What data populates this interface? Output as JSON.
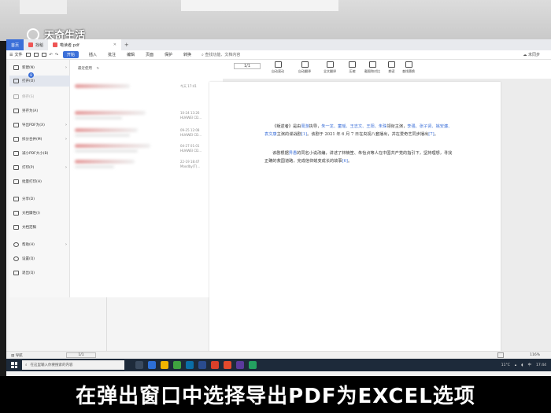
{
  "watermark": "天奇生活",
  "tabs": {
    "home": "首页",
    "tab1": "找稻",
    "tab2": "嘞读者.pdf",
    "plus": "+"
  },
  "toolbar": {
    "file": "文件",
    "start": "开始",
    "items": [
      "插入",
      "批注",
      "编辑",
      "页面",
      "保护",
      "转换"
    ],
    "search": "查找功能、文档内容",
    "right": "未同步"
  },
  "ribbon": {
    "page_value": "1/1",
    "items": [
      "自动滚动",
      "自动翻译",
      "全文翻译",
      "压缩",
      "截图和对比",
      "朗读",
      "查找替换"
    ]
  },
  "sidebar": {
    "badge": "8",
    "items": [
      {
        "label": "新建(N)",
        "arrow": "›"
      },
      {
        "label": "打开(O)",
        "arrow": ""
      },
      {
        "label": "保存(S)",
        "arrow": ""
      },
      {
        "label": "另存为(A)",
        "arrow": ""
      },
      {
        "label": "导出PDF为(X)",
        "arrow": "›"
      },
      {
        "label": "拆分合并(M)",
        "arrow": "›"
      },
      {
        "label": "减小PDF大小(B)",
        "arrow": ""
      },
      {
        "label": "打印(P)",
        "arrow": "›"
      },
      {
        "label": "批量打印(H)",
        "arrow": ""
      },
      {
        "label": "分享(D)",
        "arrow": ""
      },
      {
        "label": "文档属性(I)",
        "arrow": ""
      },
      {
        "label": "文档定稿",
        "arrow": ""
      },
      {
        "label": "帮助(H)",
        "arrow": "›"
      },
      {
        "label": "设置(Q)",
        "arrow": ""
      },
      {
        "label": "退出(Q)",
        "arrow": ""
      }
    ]
  },
  "recent": {
    "title": "最近使用",
    "refresh": "↻",
    "rows": [
      {
        "meta1": "今天 17:41",
        "meta2": ""
      },
      {
        "meta1": "10-24 13:26",
        "meta2": "HUAWEI CD..."
      },
      {
        "meta1": "09-25 12:08",
        "meta2": "HUAWEI CD..."
      },
      {
        "meta1": "04-27 01:01",
        "meta2": "HUAWEI CD..."
      },
      {
        "meta1": "22-19 18:47",
        "meta2": "Moodby(T)..."
      }
    ]
  },
  "document": {
    "p1_pre": "《叛逆者》是由",
    "p1_l1": "周游",
    "p1_m1": "执导，",
    "p1_l2": "朱一龙、童瑶、王志文、王阳、朱珠",
    "p1_m2": "领衔主演，",
    "p1_l3": "李强、张子",
    "p1_l4": "贤、姚安濂、袁文康",
    "p1_m3": "主演的谍战剧",
    "p1_l5": "[1]",
    "p1_m4": "。该剧于 2021 年 6 月 7 日在央视八套播出，并在爱",
    "p1_m5": "奇艺同步播出",
    "p1_l6": "[7]",
    "p1_end": "。",
    "p2_pre": "该剧根据",
    "p2_l1": "畀愚",
    "p2_m1": "的同名小说改编，讲述了林楠笙、朱怡贞等人在中国共产党的指引下，",
    "p2_m2": "坚持理想，寻找正确的救国道路，完成信仰蜕变成长的故事",
    "p2_l2": "[6]",
    "p2_end": "。"
  },
  "status": {
    "nav": "导航",
    "page": "1/1",
    "zoom": "116%"
  },
  "taskbar": {
    "search": "在这里输入你要搜索的内容",
    "temp": "11°C",
    "ime": "中",
    "time": "17:44"
  },
  "caption": "在弹出窗口中选择导出PDF为EXCEL选项"
}
